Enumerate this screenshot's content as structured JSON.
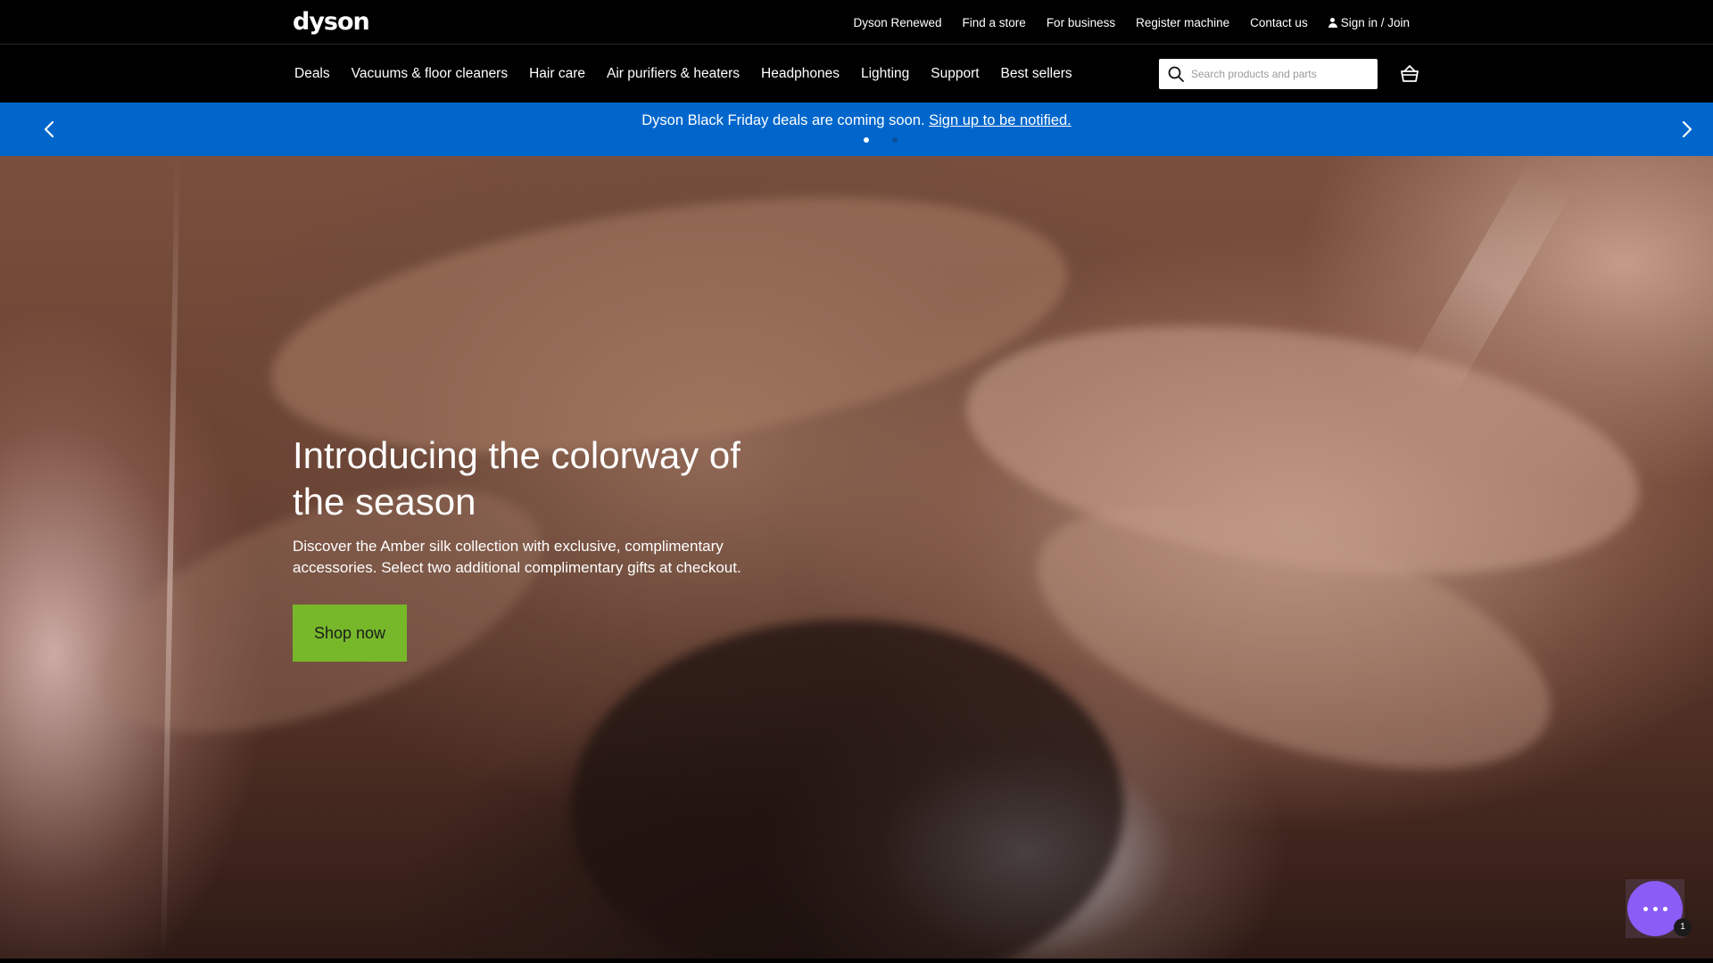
{
  "brand": {
    "logo_text": "dyson"
  },
  "utility_nav": {
    "links": [
      "Dyson Renewed",
      "Find a store",
      "For business",
      "Register machine",
      "Contact us"
    ],
    "sign_in": "Sign in / Join"
  },
  "main_nav": {
    "items": [
      "Deals",
      "Vacuums & floor cleaners",
      "Hair care",
      "Air purifiers & heaters",
      "Headphones",
      "Lighting",
      "Support",
      "Best sellers"
    ]
  },
  "search": {
    "placeholder": "Search products and parts",
    "value": ""
  },
  "promo_banner": {
    "text": "Dyson Black Friday deals are coming soon.",
    "link_text": "Sign up to be notified.",
    "active_slide": 1,
    "slide_count": 2,
    "background_color": "#0066cc"
  },
  "hero": {
    "title": "Introducing the colorway of the season",
    "subtitle": "Discover the Amber silk collection with exclusive, complimentary accessories. Select two additional complimentary gifts at checkout.",
    "cta_label": "Shop now",
    "cta_color": "#77b82a"
  },
  "chat": {
    "badge": "1",
    "button_color": "#8b5cf6"
  },
  "icons": [
    "user-icon",
    "search-icon",
    "basket-icon",
    "chevron-left-icon",
    "chevron-right-icon",
    "chat-icon"
  ]
}
